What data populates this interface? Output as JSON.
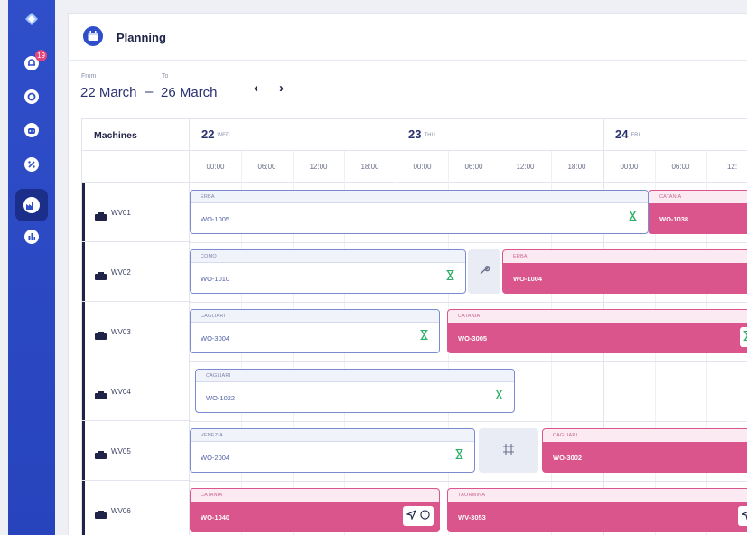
{
  "header": {
    "title": "Planning"
  },
  "range": {
    "from_label": "From",
    "to_label": "To",
    "from": "22 March",
    "to": "26 March",
    "separator": "–"
  },
  "nav": {
    "prev": "‹",
    "next": "›"
  },
  "rail": {
    "notification_count": "19"
  },
  "grid": {
    "machines_header": "Machines",
    "days": [
      {
        "day": "22",
        "weekday": "WED"
      },
      {
        "day": "23",
        "weekday": "THU"
      },
      {
        "day": "24",
        "weekday": "FRI"
      }
    ],
    "hours": [
      "00:00",
      "06:00",
      "12:00",
      "18:00",
      "00:00",
      "06:00",
      "12:00",
      "18:00",
      "00:00",
      "06:00",
      "12:"
    ]
  },
  "machines": [
    "WV01",
    "WV02",
    "WV03",
    "WV04",
    "WV05",
    "WV06"
  ],
  "jobs": {
    "wv01": [
      {
        "location": "ERBA",
        "wo": "WO-1005"
      },
      {
        "location": "CATANIA",
        "wo": "WO-1038"
      }
    ],
    "wv02": [
      {
        "location": "COMO",
        "wo": "WO-1010"
      },
      {
        "location": "ERBA",
        "wo": "WO-1004"
      }
    ],
    "wv03": [
      {
        "location": "CAGLIARI",
        "wo": "WO-3004"
      },
      {
        "location": "CATANIA",
        "wo": "WO-3005"
      }
    ],
    "wv04": [
      {
        "location": "CAGLIARI",
        "wo": "WO-1022"
      }
    ],
    "wv05": [
      {
        "location": "VENEZIA",
        "wo": "WO-2004"
      },
      {
        "location": "CAGLIARI",
        "wo": "WO-3002"
      }
    ],
    "wv06": [
      {
        "location": "CATANIA",
        "wo": "WO-1040"
      },
      {
        "location": "TAORMINA",
        "wo": "WV-3053"
      }
    ]
  },
  "colors": {
    "rail": "#2f4ec9",
    "planned": "#7b8bd0",
    "active": "#d9558b",
    "status_ok": "#2fae6a"
  },
  "icons": [
    "logo-icon",
    "notifications-icon",
    "settings-icon",
    "robot-icon",
    "discount-icon",
    "factory-icon",
    "chart-icon",
    "calendar-icon",
    "hourglass-icon",
    "wrench-icon",
    "crop-icon",
    "send-icon",
    "alert-icon",
    "machine-icon"
  ]
}
